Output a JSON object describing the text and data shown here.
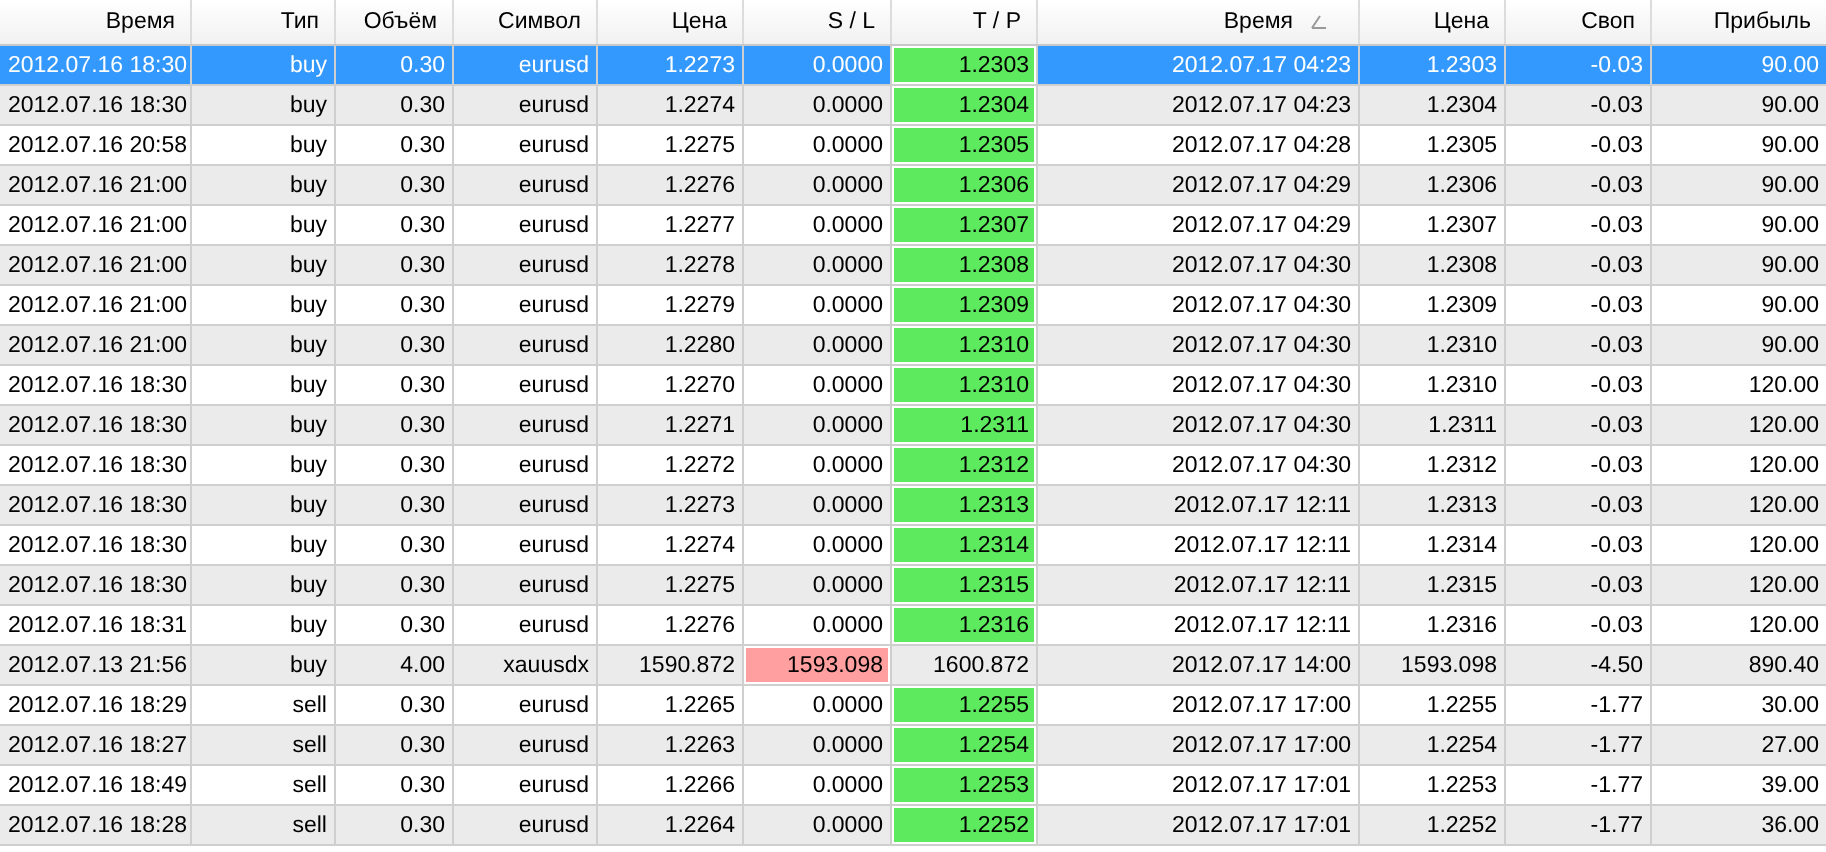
{
  "table": {
    "columns": [
      {
        "label": "Время",
        "sorted": false
      },
      {
        "label": "Тип",
        "sorted": false
      },
      {
        "label": "Объём",
        "sorted": false
      },
      {
        "label": "Символ",
        "sorted": false
      },
      {
        "label": "Цена",
        "sorted": false
      },
      {
        "label": "S / L",
        "sorted": false
      },
      {
        "label": "T / P",
        "sorted": false
      },
      {
        "label": "Время",
        "sorted": true
      },
      {
        "label": "Цена",
        "sorted": false
      },
      {
        "label": "Своп",
        "sorted": false
      },
      {
        "label": "Прибыль",
        "sorted": false
      }
    ],
    "rows": [
      {
        "selected": true,
        "sl_hit": false,
        "tp_hit": true,
        "cells": [
          "2012.07.16 18:30",
          "buy",
          "0.30",
          "eurusd",
          "1.2273",
          "0.0000",
          "1.2303",
          "2012.07.17 04:23",
          "1.2303",
          "-0.03",
          "90.00"
        ]
      },
      {
        "selected": false,
        "sl_hit": false,
        "tp_hit": true,
        "cells": [
          "2012.07.16 18:30",
          "buy",
          "0.30",
          "eurusd",
          "1.2274",
          "0.0000",
          "1.2304",
          "2012.07.17 04:23",
          "1.2304",
          "-0.03",
          "90.00"
        ]
      },
      {
        "selected": false,
        "sl_hit": false,
        "tp_hit": true,
        "cells": [
          "2012.07.16 20:58",
          "buy",
          "0.30",
          "eurusd",
          "1.2275",
          "0.0000",
          "1.2305",
          "2012.07.17 04:28",
          "1.2305",
          "-0.03",
          "90.00"
        ]
      },
      {
        "selected": false,
        "sl_hit": false,
        "tp_hit": true,
        "cells": [
          "2012.07.16 21:00",
          "buy",
          "0.30",
          "eurusd",
          "1.2276",
          "0.0000",
          "1.2306",
          "2012.07.17 04:29",
          "1.2306",
          "-0.03",
          "90.00"
        ]
      },
      {
        "selected": false,
        "sl_hit": false,
        "tp_hit": true,
        "cells": [
          "2012.07.16 21:00",
          "buy",
          "0.30",
          "eurusd",
          "1.2277",
          "0.0000",
          "1.2307",
          "2012.07.17 04:29",
          "1.2307",
          "-0.03",
          "90.00"
        ]
      },
      {
        "selected": false,
        "sl_hit": false,
        "tp_hit": true,
        "cells": [
          "2012.07.16 21:00",
          "buy",
          "0.30",
          "eurusd",
          "1.2278",
          "0.0000",
          "1.2308",
          "2012.07.17 04:30",
          "1.2308",
          "-0.03",
          "90.00"
        ]
      },
      {
        "selected": false,
        "sl_hit": false,
        "tp_hit": true,
        "cells": [
          "2012.07.16 21:00",
          "buy",
          "0.30",
          "eurusd",
          "1.2279",
          "0.0000",
          "1.2309",
          "2012.07.17 04:30",
          "1.2309",
          "-0.03",
          "90.00"
        ]
      },
      {
        "selected": false,
        "sl_hit": false,
        "tp_hit": true,
        "cells": [
          "2012.07.16 21:00",
          "buy",
          "0.30",
          "eurusd",
          "1.2280",
          "0.0000",
          "1.2310",
          "2012.07.17 04:30",
          "1.2310",
          "-0.03",
          "90.00"
        ]
      },
      {
        "selected": false,
        "sl_hit": false,
        "tp_hit": true,
        "cells": [
          "2012.07.16 18:30",
          "buy",
          "0.30",
          "eurusd",
          "1.2270",
          "0.0000",
          "1.2310",
          "2012.07.17 04:30",
          "1.2310",
          "-0.03",
          "120.00"
        ]
      },
      {
        "selected": false,
        "sl_hit": false,
        "tp_hit": true,
        "cells": [
          "2012.07.16 18:30",
          "buy",
          "0.30",
          "eurusd",
          "1.2271",
          "0.0000",
          "1.2311",
          "2012.07.17 04:30",
          "1.2311",
          "-0.03",
          "120.00"
        ]
      },
      {
        "selected": false,
        "sl_hit": false,
        "tp_hit": true,
        "cells": [
          "2012.07.16 18:30",
          "buy",
          "0.30",
          "eurusd",
          "1.2272",
          "0.0000",
          "1.2312",
          "2012.07.17 04:30",
          "1.2312",
          "-0.03",
          "120.00"
        ]
      },
      {
        "selected": false,
        "sl_hit": false,
        "tp_hit": true,
        "cells": [
          "2012.07.16 18:30",
          "buy",
          "0.30",
          "eurusd",
          "1.2273",
          "0.0000",
          "1.2313",
          "2012.07.17 12:11",
          "1.2313",
          "-0.03",
          "120.00"
        ]
      },
      {
        "selected": false,
        "sl_hit": false,
        "tp_hit": true,
        "cells": [
          "2012.07.16 18:30",
          "buy",
          "0.30",
          "eurusd",
          "1.2274",
          "0.0000",
          "1.2314",
          "2012.07.17 12:11",
          "1.2314",
          "-0.03",
          "120.00"
        ]
      },
      {
        "selected": false,
        "sl_hit": false,
        "tp_hit": true,
        "cells": [
          "2012.07.16 18:30",
          "buy",
          "0.30",
          "eurusd",
          "1.2275",
          "0.0000",
          "1.2315",
          "2012.07.17 12:11",
          "1.2315",
          "-0.03",
          "120.00"
        ]
      },
      {
        "selected": false,
        "sl_hit": false,
        "tp_hit": true,
        "cells": [
          "2012.07.16 18:31",
          "buy",
          "0.30",
          "eurusd",
          "1.2276",
          "0.0000",
          "1.2316",
          "2012.07.17 12:11",
          "1.2316",
          "-0.03",
          "120.00"
        ]
      },
      {
        "selected": false,
        "sl_hit": true,
        "tp_hit": false,
        "cells": [
          "2012.07.13 21:56",
          "buy",
          "4.00",
          "xauusdx",
          "1590.872",
          "1593.098",
          "1600.872",
          "2012.07.17 14:00",
          "1593.098",
          "-4.50",
          "890.40"
        ]
      },
      {
        "selected": false,
        "sl_hit": false,
        "tp_hit": true,
        "cells": [
          "2012.07.16 18:29",
          "sell",
          "0.30",
          "eurusd",
          "1.2265",
          "0.0000",
          "1.2255",
          "2012.07.17 17:00",
          "1.2255",
          "-1.77",
          "30.00"
        ]
      },
      {
        "selected": false,
        "sl_hit": false,
        "tp_hit": true,
        "cells": [
          "2012.07.16 18:27",
          "sell",
          "0.30",
          "eurusd",
          "1.2263",
          "0.0000",
          "1.2254",
          "2012.07.17 17:00",
          "1.2254",
          "-1.77",
          "27.00"
        ]
      },
      {
        "selected": false,
        "sl_hit": false,
        "tp_hit": true,
        "cells": [
          "2012.07.16 18:49",
          "sell",
          "0.30",
          "eurusd",
          "1.2266",
          "0.0000",
          "1.2253",
          "2012.07.17 17:01",
          "1.2253",
          "-1.77",
          "39.00"
        ]
      },
      {
        "selected": false,
        "sl_hit": false,
        "tp_hit": true,
        "cells": [
          "2012.07.16 18:28",
          "sell",
          "0.30",
          "eurusd",
          "1.2264",
          "0.0000",
          "1.2252",
          "2012.07.17 17:01",
          "1.2252",
          "-1.77",
          "36.00"
        ]
      }
    ]
  }
}
